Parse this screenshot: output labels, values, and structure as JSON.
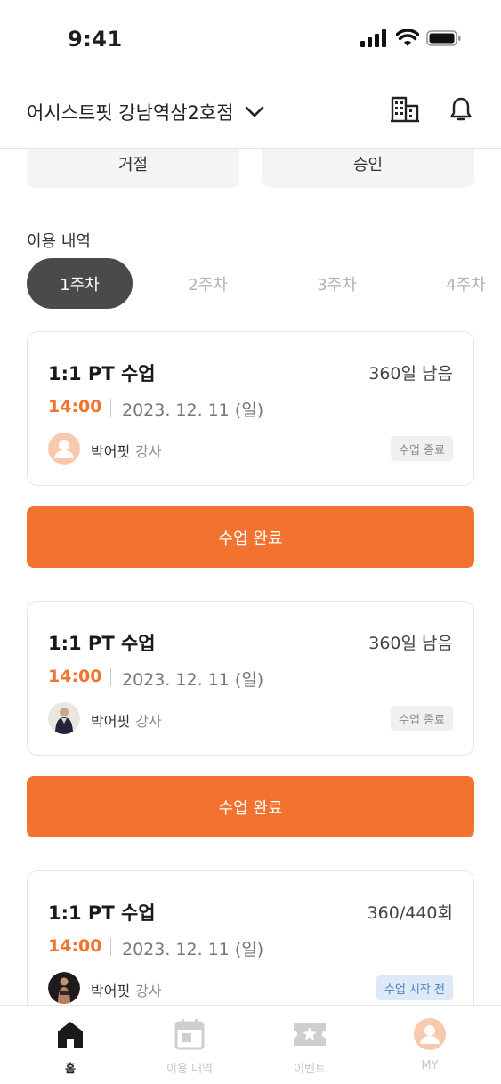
{
  "status_bar": {
    "time": "9:41"
  },
  "header": {
    "branch_name": "어시스트핏 강남역삼2호점"
  },
  "decision": {
    "reject_label": "거절",
    "approve_label": "승인"
  },
  "usage": {
    "title": "이용 내역",
    "weeks": [
      {
        "label": "1주차",
        "active": true
      },
      {
        "label": "2주차",
        "active": false
      },
      {
        "label": "3주차",
        "active": false
      },
      {
        "label": "4주차",
        "active": false
      }
    ]
  },
  "cards": [
    {
      "title": "1:1 PT 수업",
      "remaining": "360일 남음",
      "time": "14:00",
      "date": "2023. 12. 11 (일)",
      "trainer": "박어핏",
      "role": "강사",
      "badge": "수업 종료",
      "avatar": "default-avatar",
      "action_label": "수업 완료"
    },
    {
      "title": "1:1 PT 수업",
      "remaining": "360일 남음",
      "time": "14:00",
      "date": "2023. 12. 11 (일)",
      "trainer": "박어핏",
      "role": "강사",
      "badge": "수업 종료",
      "avatar": "trainer-photo",
      "action_label": "수업 완료"
    },
    {
      "title": "1:1 PT 수업",
      "remaining": "360/440회",
      "time": "14:00",
      "date": "2023. 12. 11 (일)",
      "trainer": "박어핏",
      "role": "강사",
      "badge": "수업 시작 전",
      "avatar": "trainer-photo-dark"
    }
  ],
  "tabbar": {
    "items": [
      {
        "label": "홈",
        "icon": "home-icon",
        "active": true
      },
      {
        "label": "이용 내역",
        "icon": "calendar-icon",
        "active": false
      },
      {
        "label": "이벤트",
        "icon": "ticket-star-icon",
        "active": false
      },
      {
        "label": "MY",
        "icon": "profile-icon",
        "active": false
      }
    ]
  },
  "colors": {
    "accent": "#f2732f",
    "active_tab_bg": "#4a4a4a",
    "badge_before_bg": "#dde9f7",
    "badge_before_text": "#4d7fc4"
  }
}
